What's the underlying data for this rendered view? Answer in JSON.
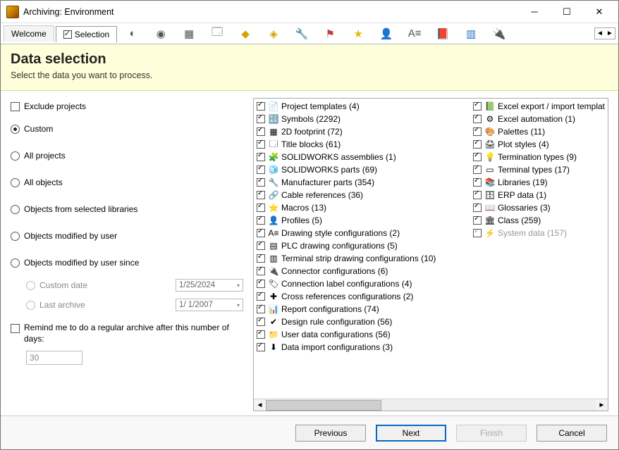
{
  "window": {
    "title": "Archiving: Environment"
  },
  "tabs": {
    "welcome": "Welcome",
    "selection": "Selection"
  },
  "banner": {
    "heading": "Data selection",
    "sub": "Select the data you want to process."
  },
  "left": {
    "exclude_projects": "Exclude projects",
    "custom": "Custom",
    "all_projects": "All projects",
    "all_objects": "All objects",
    "from_libs": "Objects from selected libraries",
    "mod_user": "Objects modified by user",
    "mod_user_since": "Objects modified by user since",
    "custom_date_lbl": "Custom date",
    "custom_date_val": "1/25/2024",
    "last_archive_lbl": "Last archive",
    "last_archive_val": "1/ 1/2007",
    "remind": "Remind me to do a regular archive after this number of days:",
    "remind_val": "30"
  },
  "list1": [
    {
      "icon": "📄",
      "label": "Project templates",
      "count": 4
    },
    {
      "icon": "🔣",
      "label": "Symbols",
      "count": 2292
    },
    {
      "icon": "▦",
      "label": "2D footprint",
      "count": 72
    },
    {
      "icon": "🗔",
      "label": "Title blocks",
      "count": 61
    },
    {
      "icon": "🧩",
      "label": "SOLIDWORKS assemblies",
      "count": 1
    },
    {
      "icon": "🧊",
      "label": "SOLIDWORKS parts",
      "count": 69
    },
    {
      "icon": "🔧",
      "label": "Manufacturer parts",
      "count": 354
    },
    {
      "icon": "🔗",
      "label": "Cable references",
      "count": 36
    },
    {
      "icon": "⭐",
      "label": "Macros",
      "count": 13
    },
    {
      "icon": "👤",
      "label": "Profiles",
      "count": 5
    },
    {
      "icon": "A≡",
      "label": "Drawing style configurations",
      "count": 2
    },
    {
      "icon": "▤",
      "label": "PLC drawing configurations",
      "count": 5
    },
    {
      "icon": "▥",
      "label": "Terminal strip drawing configurations",
      "count": 10
    },
    {
      "icon": "🔌",
      "label": "Connector configurations",
      "count": 6
    },
    {
      "icon": "🏷",
      "label": "Connection label configurations",
      "count": 4
    },
    {
      "icon": "✚",
      "label": "Cross references configurations",
      "count": 2
    },
    {
      "icon": "📊",
      "label": "Report configurations",
      "count": 74
    },
    {
      "icon": "✔",
      "label": "Design rule configuration",
      "count": 56
    },
    {
      "icon": "📁",
      "label": "User data configurations",
      "count": 56
    },
    {
      "icon": "⬇",
      "label": "Data import configurations",
      "count": 3
    }
  ],
  "list2": [
    {
      "icon": "📗",
      "label": "Excel export / import templat",
      "count": null
    },
    {
      "icon": "⚙",
      "label": "Excel automation",
      "count": 1
    },
    {
      "icon": "🎨",
      "label": "Palettes",
      "count": 11
    },
    {
      "icon": "🖨",
      "label": "Plot styles",
      "count": 4
    },
    {
      "icon": "💡",
      "label": "Termination types",
      "count": 9
    },
    {
      "icon": "▭",
      "label": "Terminal types",
      "count": 17
    },
    {
      "icon": "📚",
      "label": "Libraries",
      "count": 19
    },
    {
      "icon": "🗄",
      "label": "ERP data",
      "count": 1
    },
    {
      "icon": "📖",
      "label": "Glossaries",
      "count": 3
    },
    {
      "icon": "🏛",
      "label": "Class",
      "count": 259
    },
    {
      "icon": "⚡",
      "label": "System data",
      "count": 157,
      "disabled": true
    }
  ],
  "footer": {
    "previous": "Previous",
    "next": "Next",
    "finish": "Finish",
    "cancel": "Cancel"
  }
}
